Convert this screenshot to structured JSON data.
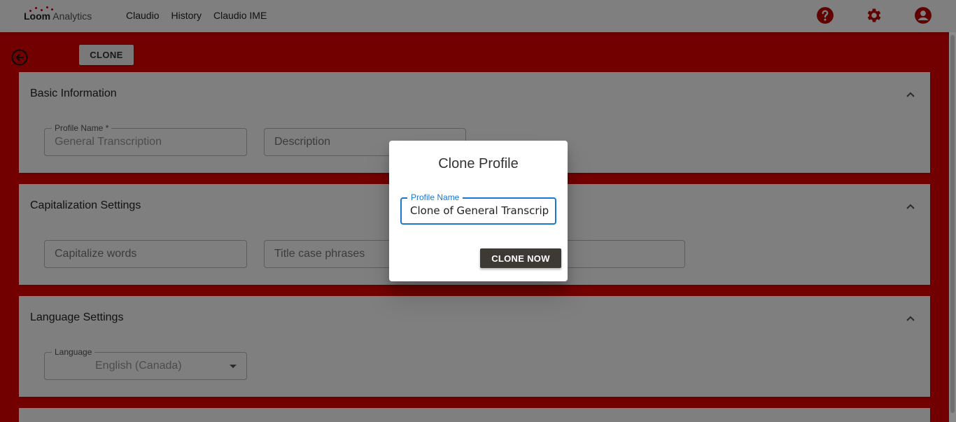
{
  "header": {
    "logo_bold": "Loom",
    "logo_rest": " Analytics",
    "nav": [
      "Claudio",
      "History",
      "Claudio IME"
    ],
    "icons": [
      "help-icon",
      "settings-gear-icon",
      "account-icon"
    ]
  },
  "toolbar": {
    "clone_label": "CLONE"
  },
  "panels": {
    "basic": {
      "title": "Basic Information",
      "profile_name_label": "Profile Name *",
      "profile_name_value": "General Transcription",
      "description_placeholder": "Description"
    },
    "capitalization": {
      "title": "Capitalization Settings",
      "capitalize_placeholder": "Capitalize words",
      "title_case_placeholder": "Title case phrases"
    },
    "language": {
      "title": "Language Settings",
      "language_label": "Language",
      "language_value": "English (Canada)"
    }
  },
  "dialog": {
    "title": "Clone Profile",
    "field_label": "Profile Name",
    "field_value": "Clone of General Transcription",
    "button_label": "CLONE NOW"
  },
  "colors": {
    "accent_red": "#e60000",
    "icon_red": "#c00000",
    "focus_blue": "#1976d2",
    "dialog_button": "#3d3a35"
  }
}
